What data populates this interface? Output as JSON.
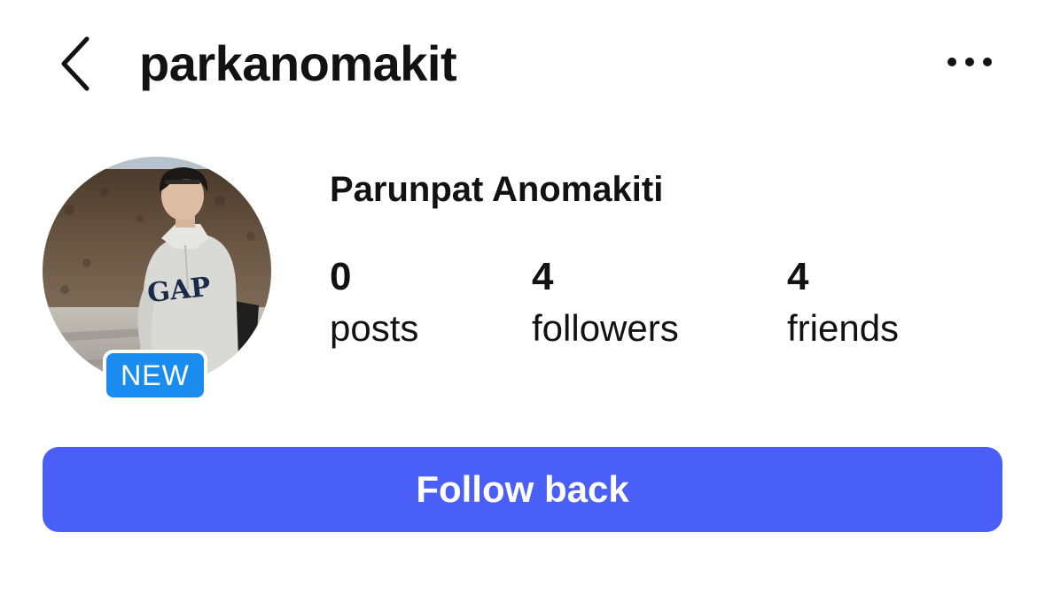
{
  "header": {
    "back_icon": "chevron-left-icon",
    "username": "parkanomakit",
    "more_icon": "more-horizontal-icon"
  },
  "profile": {
    "avatar": "profile-photo",
    "badge": "NEW",
    "badge_color": "#1a8cf0",
    "full_name": "Parunpat Anomakiti",
    "stats": [
      {
        "count": "0",
        "label": "posts"
      },
      {
        "count": "4",
        "label": "followers"
      },
      {
        "count": "4",
        "label": "friends"
      }
    ]
  },
  "actions": {
    "follow_back_label": "Follow back",
    "follow_back_color": "#4a5ff7"
  }
}
